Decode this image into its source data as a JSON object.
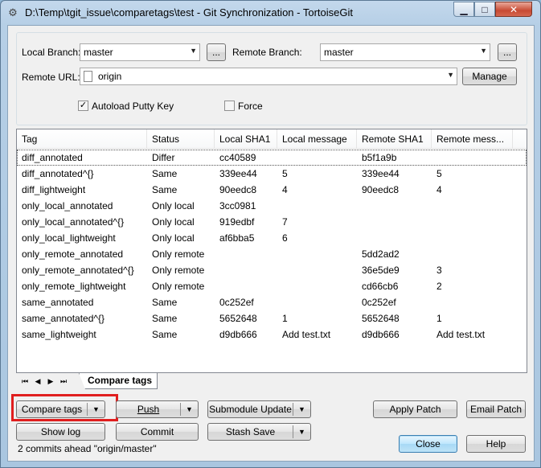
{
  "window": {
    "title": "D:\\Temp\\tgit_issue\\comparetags\\test - Git Synchronization - TortoiseGit",
    "min_glyph": "▁",
    "max_glyph": "□",
    "close_glyph": "✕"
  },
  "form": {
    "local_branch_label": "Local Branch:",
    "local_branch_value": "master",
    "remote_branch_label": "Remote Branch:",
    "remote_branch_value": "master",
    "browse_label": "...",
    "remote_url_label": "Remote URL:",
    "remote_url_value": "origin",
    "manage_label": "Manage",
    "autoload_label": "Autoload Putty Key",
    "autoload_checked": "✓",
    "force_label": "Force"
  },
  "table": {
    "columns": [
      "Tag",
      "Status",
      "Local SHA1",
      "Local message",
      "Remote SHA1",
      "Remote mess..."
    ],
    "rows": [
      [
        "diff_annotated",
        "Differ",
        "cc40589",
        "",
        "b5f1a9b",
        ""
      ],
      [
        "diff_annotated^{}",
        "Same",
        "339ee44",
        "5",
        "339ee44",
        "5"
      ],
      [
        "diff_lightweight",
        "Same",
        "90eedc8",
        "4",
        "90eedc8",
        "4"
      ],
      [
        "only_local_annotated",
        "Only local",
        "3cc0981",
        "",
        "",
        ""
      ],
      [
        "only_local_annotated^{}",
        "Only local",
        "919edbf",
        "7",
        "",
        ""
      ],
      [
        "only_local_lightweight",
        "Only local",
        "af6bba5",
        "6",
        "",
        ""
      ],
      [
        "only_remote_annotated",
        "Only remote",
        "",
        "",
        "5dd2ad2",
        ""
      ],
      [
        "only_remote_annotated^{}",
        "Only remote",
        "",
        "",
        "36e5de9",
        "3"
      ],
      [
        "only_remote_lightweight",
        "Only remote",
        "",
        "",
        "cd66cb6",
        "2"
      ],
      [
        "same_annotated",
        "Same",
        "0c252ef",
        "",
        "0c252ef",
        ""
      ],
      [
        "same_annotated^{}",
        "Same",
        "5652648",
        "1",
        "5652648",
        "1"
      ],
      [
        "same_lightweight",
        "Same",
        "d9db666",
        "Add        test.txt",
        "d9db666",
        "Add        test.txt"
      ]
    ]
  },
  "tabs": {
    "nav_first": "⏮",
    "nav_prev": "◀",
    "nav_next": "▶",
    "nav_last": "⏭",
    "active_label": "Compare tags"
  },
  "buttons": {
    "compare_tags": "Compare tags",
    "push": "Push",
    "submodule_update": "Submodule Update",
    "apply_patch": "Apply Patch",
    "email_patch": "Email Patch",
    "show_log": "Show log",
    "commit": "Commit",
    "stash_save": "Stash Save",
    "close": "Close",
    "help": "Help",
    "drop_glyph": "▼"
  },
  "status": {
    "text": "2 commits ahead \"origin/master\""
  },
  "colors": {
    "highlight_border": "#e01e1e"
  }
}
